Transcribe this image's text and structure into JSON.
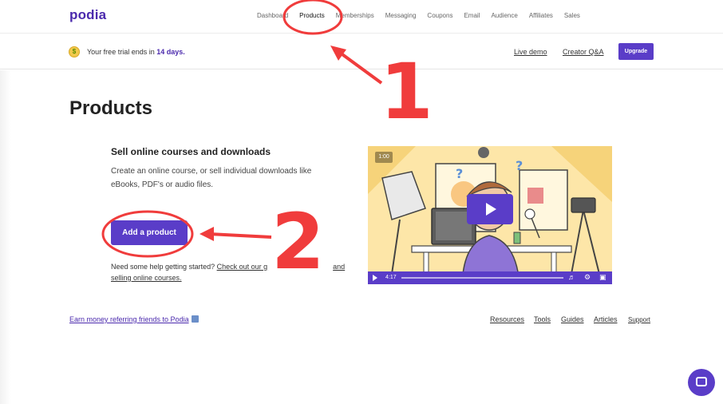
{
  "header": {
    "logo": "podia",
    "nav": [
      "Dashboard",
      "Products",
      "Memberships",
      "Messaging",
      "Coupons",
      "Email",
      "Audience",
      "Affiliates",
      "Sales"
    ],
    "active_nav": "Products"
  },
  "trial": {
    "prefix": "Your free trial ends in",
    "days": "14 days.",
    "live_demo": "Live demo",
    "creator_qa": "Creator Q&A",
    "upgrade": "Upgrade"
  },
  "main": {
    "title": "Products",
    "section_title": "Sell online courses and downloads",
    "description": "Create an online course, or sell individual downloads like eBooks, PDF's or audio files.",
    "add_button": "Add a product",
    "help_prefix": "Need some help getting started?",
    "help_link": "Check out our g",
    "help_link_end": "and",
    "help_link_line2": "selling online courses."
  },
  "video": {
    "badge": "1:00",
    "time": "4:17"
  },
  "footer": {
    "refer": "Earn money referring friends to Podia",
    "links": [
      "Resources",
      "Tools",
      "Guides",
      "Articles",
      "Support"
    ]
  },
  "annotations": {
    "label_1": "1",
    "label_2": "2",
    "color": "#f03c3c"
  }
}
